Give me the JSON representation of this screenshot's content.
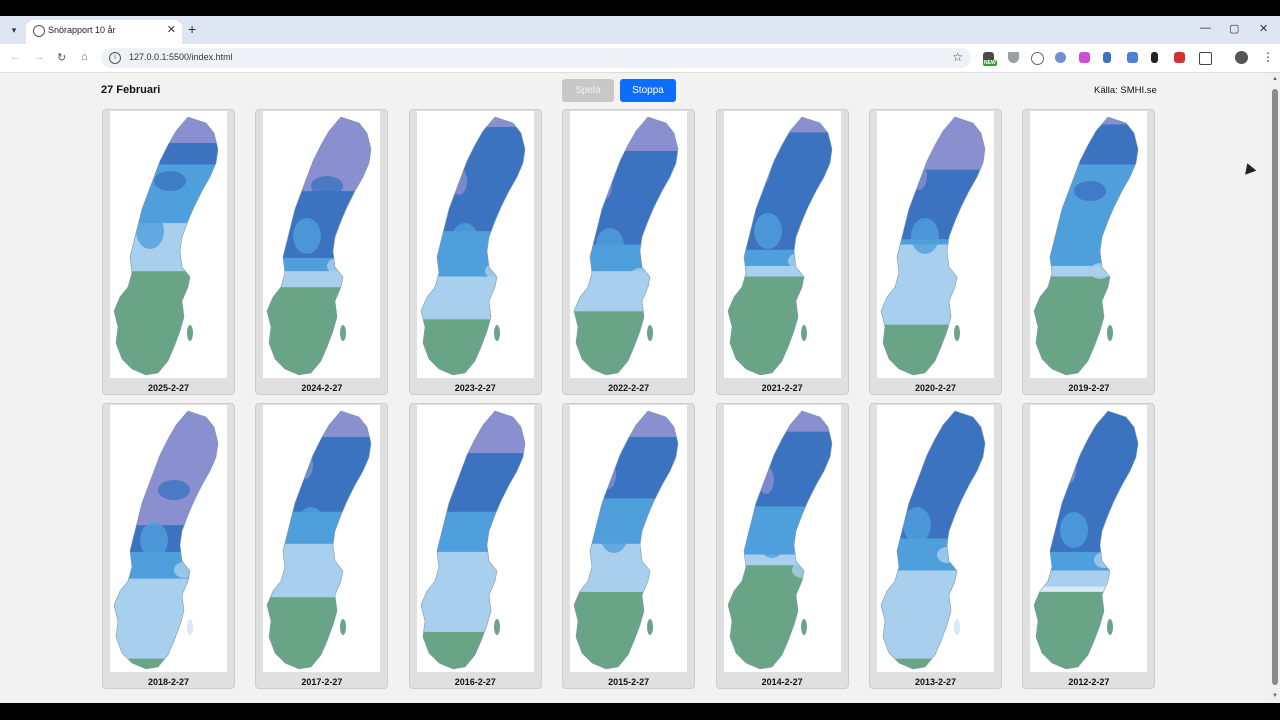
{
  "browser": {
    "tab_title": "Snörapport 10 år",
    "url": "127.0.0.1:5500/index.html",
    "new_tab": "+",
    "window_controls": [
      "—",
      "▢",
      "✕"
    ]
  },
  "page": {
    "date_label": "27 Februari",
    "play_label": "Spela",
    "stop_label": "Stoppa",
    "source_label": "Källa: SMHI.se"
  },
  "colors": {
    "accent": "#0d6efd",
    "snow_deep": "#3b73c0",
    "snow_mid": "#4f9fdc",
    "snow_light": "#a8d0ee",
    "snow_thin": "#dbe8f5",
    "snow_max": "#8a8fcf",
    "no_snow": "#6aa487"
  },
  "maps": [
    {
      "label": "2025-2-27",
      "line": 0.58,
      "cover": [
        0.12,
        0.2,
        0.42,
        0.6
      ]
    },
    {
      "label": "2024-2-27",
      "line": 0.62,
      "cover": [
        0.3,
        0.55,
        0.6,
        0.66
      ]
    },
    {
      "label": "2023-2-27",
      "line": 0.72,
      "cover": [
        0.06,
        0.45,
        0.62,
        0.78
      ]
    },
    {
      "label": "2022-2-27",
      "line": 0.66,
      "cover": [
        0.15,
        0.5,
        0.6,
        0.75
      ]
    },
    {
      "label": "2021-2-27",
      "line": 0.6,
      "cover": [
        0.08,
        0.52,
        0.58,
        0.62
      ]
    },
    {
      "label": "2020-2-27",
      "line": 0.52,
      "cover": [
        0.22,
        0.48,
        0.5,
        0.8
      ]
    },
    {
      "label": "2019-2-27",
      "line": 0.6,
      "cover": [
        0.05,
        0.2,
        0.58,
        0.62
      ]
    },
    {
      "label": "2018-2-27",
      "line": 0.95,
      "cover": [
        0.45,
        0.55,
        0.65,
        0.95
      ]
    },
    {
      "label": "2017-2-27",
      "line": 0.7,
      "cover": [
        0.12,
        0.4,
        0.52,
        0.72
      ]
    },
    {
      "label": "2016-2-27",
      "line": 0.66,
      "cover": [
        0.18,
        0.4,
        0.55,
        0.85
      ]
    },
    {
      "label": "2015-2-27",
      "line": 0.68,
      "cover": [
        0.12,
        0.35,
        0.52,
        0.7
      ]
    },
    {
      "label": "2014-2-27",
      "line": 0.58,
      "cover": [
        0.1,
        0.38,
        0.56,
        0.6
      ]
    },
    {
      "label": "2013-2-27",
      "line": 0.95,
      "cover": [
        0.0,
        0.5,
        0.62,
        0.95
      ]
    },
    {
      "label": "2012-2-27",
      "line": 0.7,
      "cover": [
        0.0,
        0.55,
        0.62,
        0.68
      ]
    }
  ]
}
